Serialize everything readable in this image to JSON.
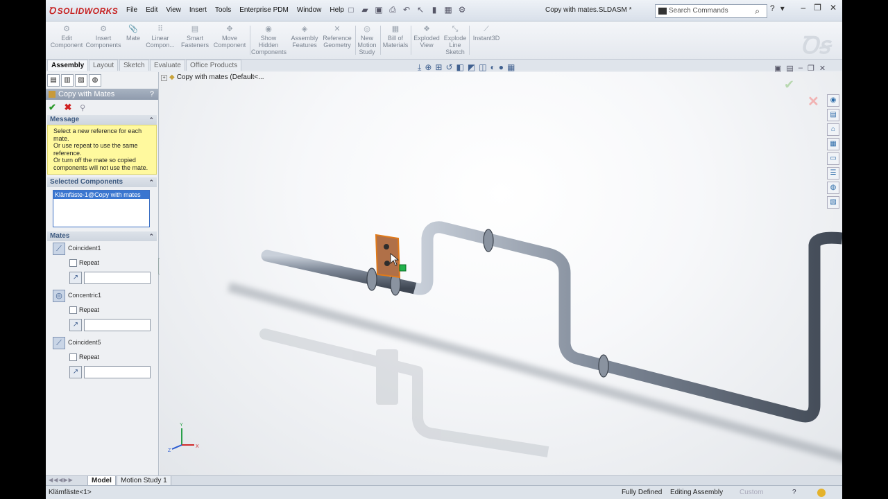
{
  "app": {
    "brand": "SOLIDWORKS",
    "document_title": "Copy with mates.SLDASM *"
  },
  "menu": [
    "File",
    "Edit",
    "View",
    "Insert",
    "Tools",
    "Enterprise PDM",
    "Window",
    "Help"
  ],
  "search": {
    "placeholder": "Search Commands"
  },
  "command_manager": [
    {
      "label": "Edit\nComponent"
    },
    {
      "label": "Insert\nComponents"
    },
    {
      "label": "Mate"
    },
    {
      "label": "Linear\nCompon..."
    },
    {
      "label": "Smart\nFasteners"
    },
    {
      "label": "Move\nComponent"
    },
    {
      "label": "Show\nHidden\nComponents"
    },
    {
      "label": "Assembly\nFeatures"
    },
    {
      "label": "Reference\nGeometry"
    },
    {
      "label": "New\nMotion\nStudy"
    },
    {
      "label": "Bill of\nMaterials"
    },
    {
      "label": "Exploded\nView"
    },
    {
      "label": "Explode\nLine\nSketch"
    },
    {
      "label": "Instant3D"
    }
  ],
  "tabs": [
    "Assembly",
    "Layout",
    "Sketch",
    "Evaluate",
    "Office Products"
  ],
  "property_manager": {
    "title": "Copy with Mates",
    "help": "?",
    "message_header": "Message",
    "message": "Select a new reference for each mate.\nOr use repeat to use the same reference.\nOr turn off the mate so copied components will not use the mate.",
    "selected_header": "Selected Components",
    "selected_items": [
      "Klämfäste-1@Copy with mates"
    ],
    "mates_header": "Mates",
    "mates": [
      {
        "name": "Coincident1",
        "repeat_label": "Repeat",
        "repeat_checked": false
      },
      {
        "name": "Concentric1",
        "repeat_label": "Repeat",
        "repeat_checked": false
      },
      {
        "name": "Coincident5",
        "repeat_label": "Repeat",
        "repeat_checked": false
      }
    ]
  },
  "feature_tree": {
    "root": "Copy with mates  (Default<..."
  },
  "triad": {
    "x": "X",
    "y": "Y",
    "z": "Z"
  },
  "bottom_tabs": [
    "Model",
    "Motion Study 1"
  ],
  "status": {
    "selection": "Klämfäste<1>",
    "definition": "Fully Defined",
    "mode": "Editing Assembly",
    "units": "Custom",
    "help": "?"
  },
  "colors": {
    "accent": "#3a76d0",
    "message_bg": "#fff99e",
    "pipe": "#6f7a88",
    "bracket": "#b5764a",
    "selection_orange": "#d9721f"
  }
}
